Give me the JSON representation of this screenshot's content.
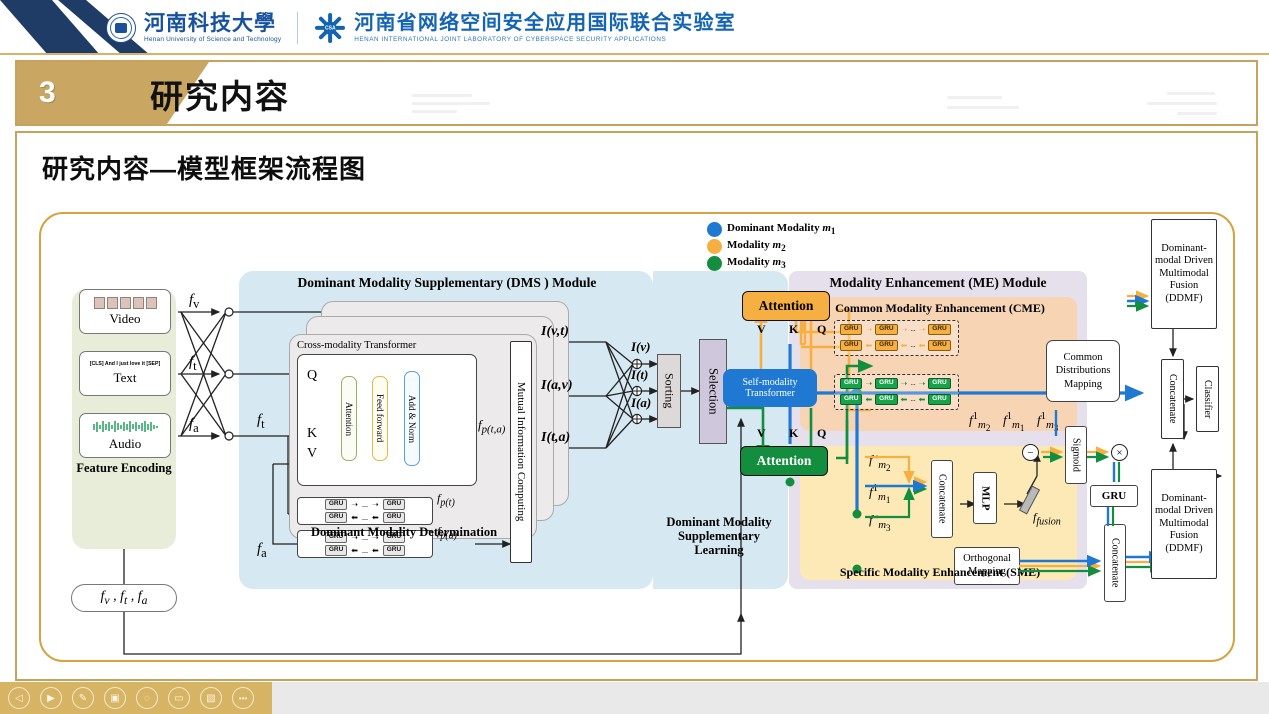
{
  "header": {
    "university_cn": "河南科技大學",
    "university_en": "Henan University of Science and Technology",
    "lab_cn": "河南省网络空间安全应用国际联合实验室",
    "lab_en": "HENAN INTERNATIONAL JOINT LABORATORY OF CYBERSPACE SECURITY APPLICATIONS",
    "seal_icon": "university-seal-icon",
    "snowflake_icon": "snowflake-logo-icon"
  },
  "section": {
    "number": "3",
    "title": "研究内容"
  },
  "slide": {
    "heading": "研究内容—模型框架流程图"
  },
  "diagram": {
    "feature_encoding": {
      "label": "Feature Encoding",
      "items": [
        {
          "name": "Video",
          "icon": "video-frames-icon",
          "out": "f_v"
        },
        {
          "name": "Text",
          "sample": "[CLS] And I just love it [SEP]",
          "out": "f_t"
        },
        {
          "name": "Audio",
          "icon": "audio-waveform-icon",
          "out": "f_a"
        }
      ],
      "bundle": "f_v , f_t , f_a"
    },
    "dms": {
      "title": "Dominant Modality Supplementary (DMS ) Module",
      "sub_left": "Dominant Modality Determination",
      "sub_right": "Dominant Modality Supplementary Learning",
      "cross_modality_transformer": {
        "title": "Cross-modality Transformer",
        "inputs": [
          "Q",
          "K",
          "V"
        ],
        "stages": [
          "Attention",
          "Feed forward",
          "Add & Norm"
        ],
        "output": "f_p(t,a)"
      },
      "gru_rows": [
        {
          "output": "f_p(t)"
        },
        {
          "output": "f_p(a)"
        }
      ],
      "gru_cell": "GRU",
      "gru_ellipsis": "...",
      "mutual_info": "Mutual Information Computing",
      "mi_outputs": [
        "I(v,t)",
        "I(a,v)",
        "I(t,a)"
      ],
      "sum_outputs": [
        "I(v)",
        "I(t)",
        "I(a)"
      ],
      "sorting": "Sorting",
      "selection": "Selection",
      "input_labels": [
        "f_t",
        "f_a"
      ]
    },
    "legend": [
      {
        "label": "Dominant Modality",
        "sub": "m1",
        "color": "#1f78d1"
      },
      {
        "label": "Modality",
        "sub": "m2",
        "color": "#f5b041"
      },
      {
        "label": "Modality",
        "sub": "m3",
        "color": "#138d3e"
      }
    ],
    "supplementary": {
      "attention_top": "Attention",
      "attention_bottom": "Attention",
      "self_modality_transformer": "Self-modality Transformer",
      "qkv": [
        "V",
        "K",
        "Q"
      ]
    },
    "me": {
      "title": "Modality Enhancement (ME) Module",
      "cme": {
        "title": "Common Modality Enhancement (CME)",
        "mapping": "Common Distributions Mapping",
        "gru_cell": "GRU",
        "ellipsis": "..."
      },
      "sme": {
        "title": "Specific Modality Enhancement (SME)",
        "inputs": [
          "f'_m2",
          "f1_m1",
          "f'_m3"
        ],
        "concatenate": "Concatenate",
        "mlp": "MLP",
        "fusion_label": "f_fusion",
        "minus": "−",
        "sigmoid": "Sigmoid",
        "times": "×",
        "gru": "GRU",
        "orthogonal": "Orthogonal Mapping",
        "concatenate2": "Concatenate"
      },
      "mid_labels": [
        "f1_m2",
        "f1_m1",
        "f1_m3"
      ]
    },
    "output": {
      "ddmf_top": "Dominant-modal Driven Multimodal Fusion (DDMF)",
      "ddmf_bottom": "Dominant-modal Driven Multimodal Fusion (DDMF)",
      "concatenate": "Concatenate",
      "classifier": "Classifier"
    }
  },
  "toolbar": {
    "buttons": [
      {
        "name": "previous-slide",
        "glyph": "◁"
      },
      {
        "name": "play-slide",
        "glyph": "▶"
      },
      {
        "name": "pen-tool",
        "glyph": "✎"
      },
      {
        "name": "slide-grid",
        "glyph": "▣"
      },
      {
        "name": "zoom-tool",
        "glyph": "◌"
      },
      {
        "name": "subtitles",
        "glyph": "▭"
      },
      {
        "name": "camera-off",
        "glyph": "▧"
      },
      {
        "name": "more-options",
        "glyph": "•••"
      }
    ]
  },
  "colors": {
    "gold": "#c6a25c",
    "dms_panel": "#d6e8f2",
    "me_panel": "#e6e0ec",
    "cme_panel": "#f7d4b4",
    "sme_panel": "#fce9b5",
    "feature_panel": "#e7edd8",
    "blue": "#1f78d1",
    "orange": "#f5b041",
    "green": "#138d3e"
  }
}
